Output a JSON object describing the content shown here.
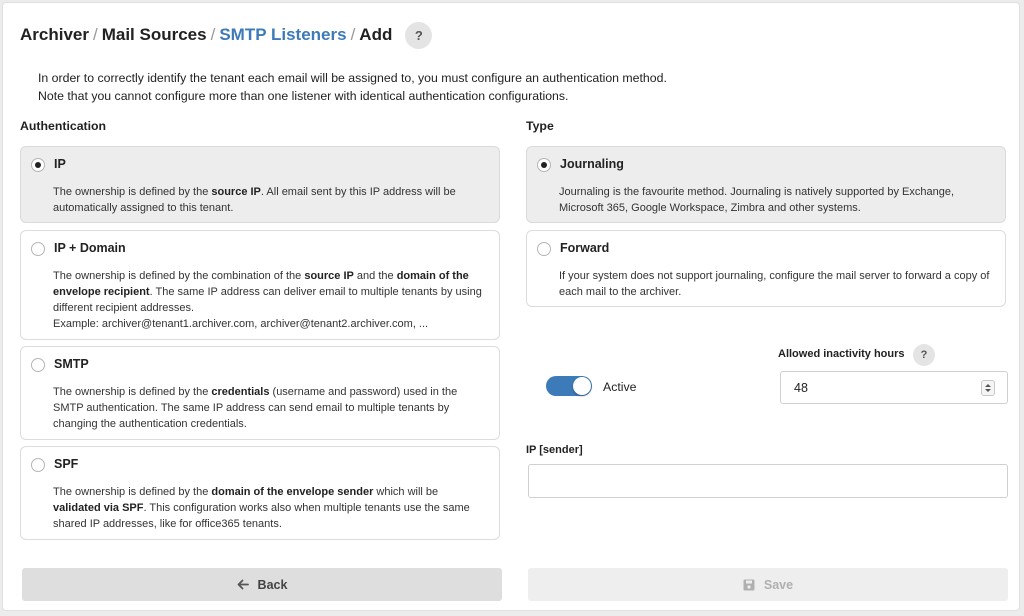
{
  "breadcrumb": {
    "items": [
      "Archiver",
      "Mail Sources",
      "SMTP Listeners",
      "Add"
    ],
    "separator": "/",
    "help_label": "?"
  },
  "intro": {
    "line1": "In order to correctly identify the tenant each email will be assigned to, you must configure an authentication method.",
    "line2": "Note that you cannot configure more than one listener with identical authentication configurations."
  },
  "authentication": {
    "label": "Authentication",
    "selected": "IP",
    "options": [
      {
        "title": "IP",
        "desc_parts": [
          "The ownership is defined by the ",
          "source IP",
          ". All email sent by this IP address will be automatically assigned to this tenant."
        ]
      },
      {
        "title": "IP + Domain",
        "desc_parts": [
          "The ownership is defined by the combination of the ",
          "source IP",
          " and the ",
          "domain of the envelope recipient",
          ". The same IP address can deliver email to multiple tenants by using different recipient addresses."
        ],
        "example": "Example: archiver@tenant1.archiver.com, archiver@tenant2.archiver.com, ..."
      },
      {
        "title": "SMTP",
        "desc_parts": [
          "The ownership is defined by the ",
          "credentials",
          " (username and password) used in the SMTP authentication. The same IP address can send email to multiple tenants by changing the authentication credentials."
        ]
      },
      {
        "title": "SPF",
        "desc_parts": [
          "The ownership is defined by the ",
          "domain of the envelope sender",
          " which will be ",
          "validated via SPF",
          ". This configuration works also when multiple tenants use the same shared IP addresses, like for office365 tenants."
        ]
      }
    ]
  },
  "type": {
    "label": "Type",
    "selected": "Journaling",
    "options": [
      {
        "title": "Journaling",
        "desc": "Journaling is the favourite method. Journaling is natively supported by Exchange, Microsoft 365, Google Workspace, Zimbra and other systems."
      },
      {
        "title": "Forward",
        "desc": "If your system does not support journaling, configure the mail server to forward a copy of each mail to the archiver."
      }
    ]
  },
  "active": {
    "label": "Active",
    "on": true
  },
  "inactivity": {
    "label": "Allowed inactivity hours",
    "help_label": "?",
    "value": "48"
  },
  "ip_sender": {
    "label": "IP [sender]",
    "value": ""
  },
  "buttons": {
    "back": "Back",
    "save": "Save"
  },
  "colors": {
    "accent": "#3d7ab8",
    "selected_bg": "#ededed"
  }
}
